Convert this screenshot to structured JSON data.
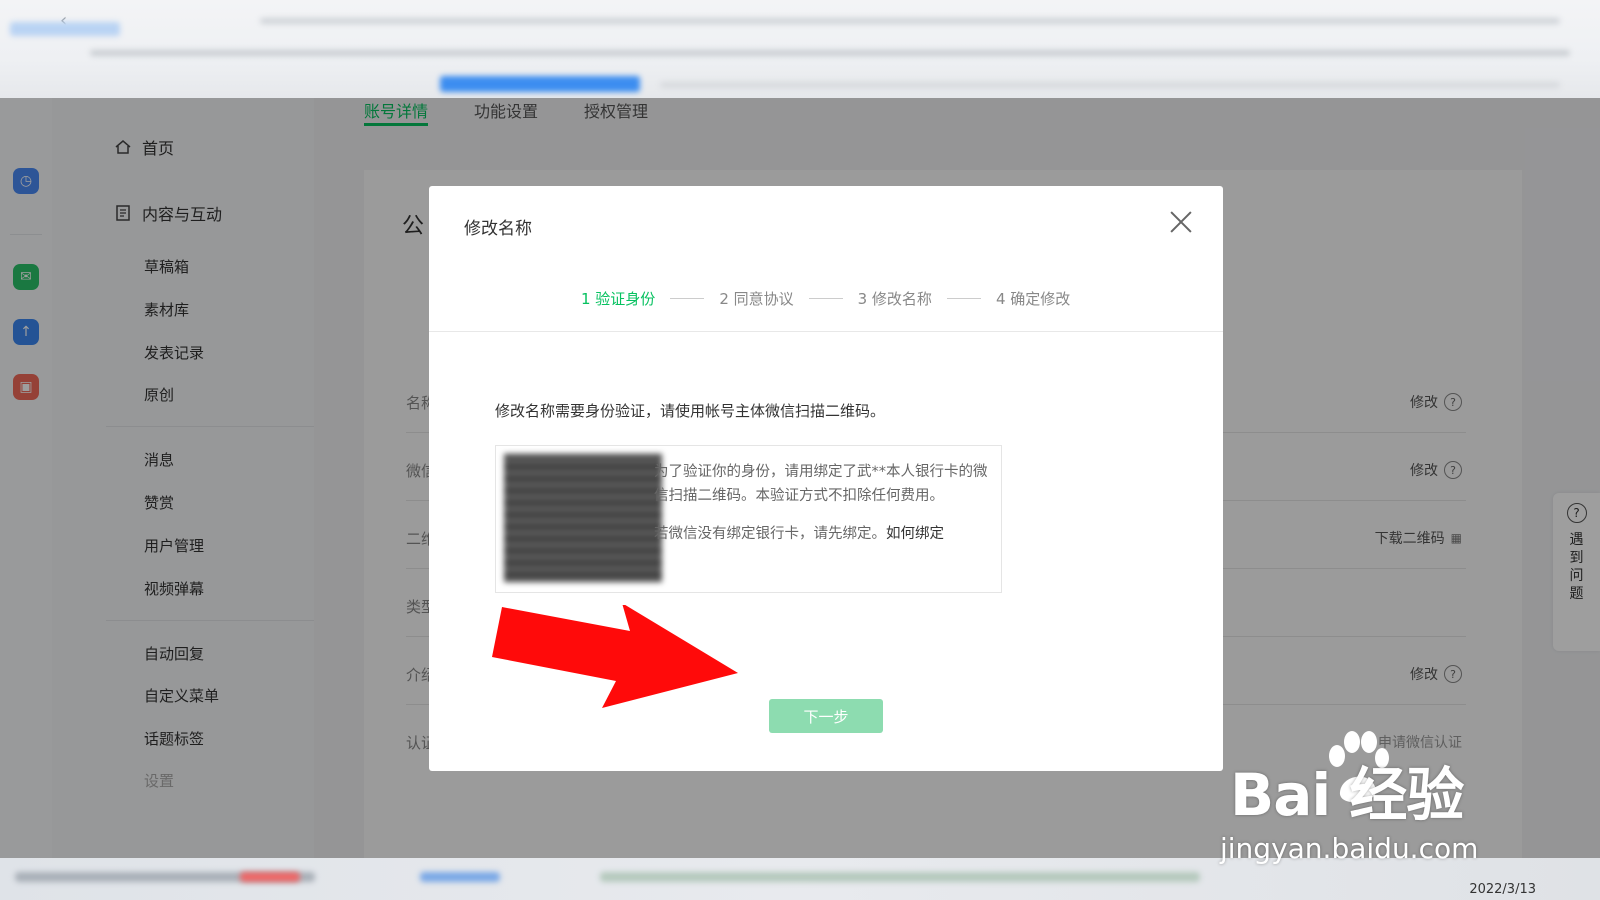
{
  "sidebar": {
    "home": "首页",
    "group": "内容与互动",
    "items": [
      "草稿箱",
      "素材库",
      "发表记录",
      "原创",
      "消息",
      "赞赏",
      "用户管理",
      "视频弹幕",
      "自动回复",
      "自定义菜单",
      "话题标签",
      "设置"
    ]
  },
  "main": {
    "tabs": [
      "账号详情",
      "功能设置",
      "授权管理"
    ],
    "card_title": "公",
    "row_labels": [
      "名称",
      "微信",
      "二维",
      "类型",
      "介绍",
      "认证"
    ],
    "actions": {
      "modify": "修改",
      "download_qr": "下载二维码",
      "apply_cert": "申请微信认证"
    }
  },
  "modal": {
    "title": "修改名称",
    "steps": [
      "1 验证身份",
      "2 同意协议",
      "3 修改名称",
      "4 确定修改"
    ],
    "instruction": "修改名称需要身份验证，请使用帐号主体微信扫描二维码。",
    "qr_text_1": "为了验证你的身份，请用绑定了武**本人银行卡的微信扫描二维码。本验证方式不扣除任何费用。",
    "qr_text_2": "若微信没有绑定银行卡，请先绑定。",
    "qr_link": "如何绑定",
    "next_button": "下一步"
  },
  "help": {
    "label": "遇到问题"
  },
  "taskbar": {
    "date": "2022/3/13"
  },
  "watermark": {
    "main": "Bai  经验",
    "sub": "jingyan.baidu.com"
  },
  "colors": {
    "accent": "#07c160",
    "arrow": "#ff0a0a",
    "button_disabled": "#8ddcb0"
  },
  "icons": {
    "home": "home-icon",
    "doc": "document-icon",
    "close": "close-icon",
    "help": "question-icon"
  }
}
